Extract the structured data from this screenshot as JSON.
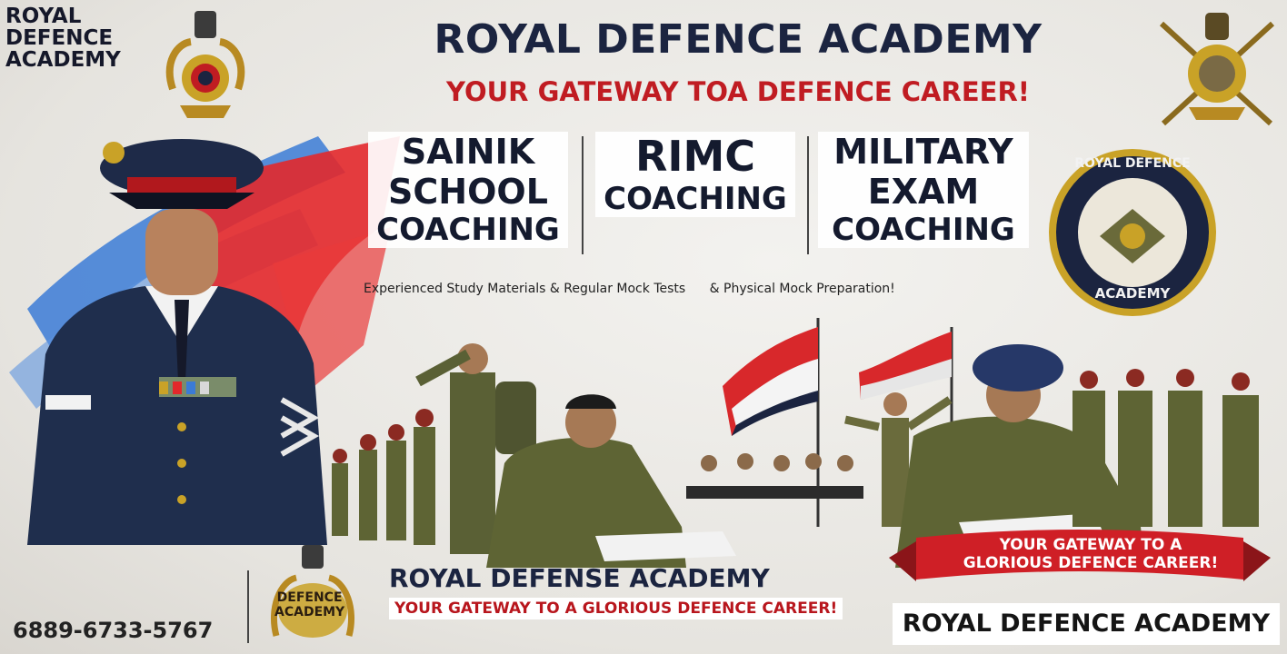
{
  "header": {
    "brand_lines": [
      "ROYAL",
      "DEFENCE",
      "ACADEMY"
    ],
    "title": "ROYAL DEFENCE ACADEMY",
    "subtitle": "YOUR GATEWAY TOA DEFENCE CAREER!"
  },
  "services": [
    {
      "line1": "SAINIK",
      "line2": "SCHOOL",
      "line3": "COACHING"
    },
    {
      "line1": "RIMC",
      "line2": "COACHING"
    },
    {
      "line1": "MILITARY",
      "line2": "EXAM",
      "line3": "COACHING"
    }
  ],
  "features": [
    "Experienced Study Materials & Regular Mock Tests",
    "& Physical Mock Preparation!"
  ],
  "badge": {
    "top_text": "ROYAL DEFENCE",
    "bottom_text": "ACADEMY"
  },
  "ribbon": {
    "line1": "YOUR GATEWAY TO A",
    "line2": "GLORIOUS DEFENCE CAREER!"
  },
  "bottom": {
    "phone": "6889-6733-5767",
    "logo_lines": [
      "DEFENCE",
      "ACADEMY"
    ],
    "title": "ROYAL DEFENSE ACADEMY",
    "subtitle": "YOUR GATEWAY TO A GLORIOUS DEFENCE CAREER!",
    "right_title": "ROYAL DEFENCE ACADEMY"
  },
  "colors": {
    "navy": "#1b2440",
    "red": "#c01c22",
    "olive": "#5e6434",
    "gold": "#c9a227"
  }
}
